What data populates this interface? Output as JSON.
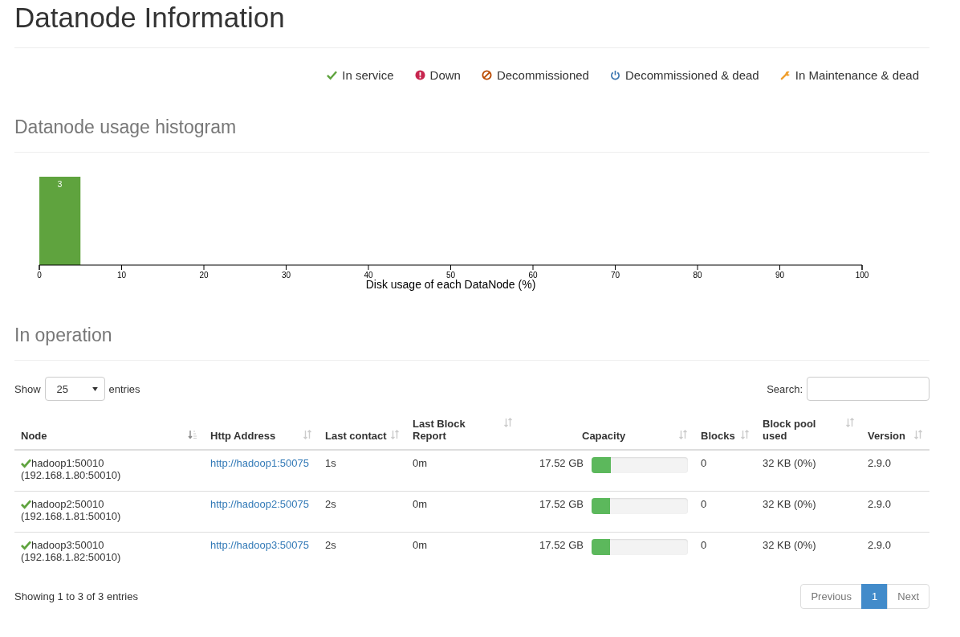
{
  "title": "Datanode Information",
  "legend": [
    {
      "kind": "in-service",
      "label": "In service"
    },
    {
      "kind": "down",
      "label": "Down"
    },
    {
      "kind": "decommissioned",
      "label": "Decommissioned"
    },
    {
      "kind": "decommissioned-dead",
      "label": "Decommissioned & dead"
    },
    {
      "kind": "maintenance-dead",
      "label": "In Maintenance & dead"
    }
  ],
  "histogram": {
    "heading": "Datanode usage histogram",
    "chart_data": {
      "type": "bar",
      "xlabel": "Disk usage of each DataNode (%)",
      "x": [
        2.5
      ],
      "values": [
        3
      ],
      "xlim": [
        0,
        100
      ],
      "xticks": [
        0,
        10,
        20,
        30,
        40,
        50,
        60,
        70,
        80,
        90,
        100
      ],
      "data_labels": true
    }
  },
  "operation": {
    "heading": "In operation",
    "show_label": "Show",
    "page_size": "25",
    "entries_label": "entries",
    "search_label": "Search:",
    "columns": [
      {
        "label": "Node",
        "sorted": true
      },
      {
        "label": "Http Address",
        "sorted": false
      },
      {
        "label": "Last contact",
        "sorted": false
      },
      {
        "label": "Last Block Report",
        "sorted": false
      },
      {
        "label": "Capacity",
        "sorted": false
      },
      {
        "label": "Blocks",
        "sorted": false
      },
      {
        "label": "Block pool used",
        "sorted": false
      },
      {
        "label": "Version",
        "sorted": false
      }
    ],
    "rows": [
      {
        "kind": "in-service",
        "node": "hadoop1:50010",
        "address": "(192.168.1.80:50010)",
        "http": "http://hadoop1:50075",
        "last_contact": "1s",
        "last_block_report": "0m",
        "capacity": "17.52 GB",
        "level": 0.2,
        "blocks": "0",
        "block_pool_used": "32 KB (0%)",
        "version": "2.9.0"
      },
      {
        "kind": "in-service",
        "node": "hadoop2:50010",
        "address": "(192.168.1.81:50010)",
        "http": "http://hadoop2:50075",
        "last_contact": "2s",
        "last_block_report": "0m",
        "capacity": "17.52 GB",
        "level": 0.19,
        "blocks": "0",
        "block_pool_used": "32 KB (0%)",
        "version": "2.9.0"
      },
      {
        "kind": "in-service",
        "node": "hadoop3:50010",
        "address": "(192.168.1.82:50010)",
        "http": "http://hadoop3:50075",
        "last_contact": "2s",
        "last_block_report": "0m",
        "capacity": "17.52 GB",
        "level": 0.19,
        "blocks": "0",
        "block_pool_used": "32 KB (0%)",
        "version": "2.9.0"
      }
    ],
    "info": "Showing 1 to 3 of 3 entries",
    "pagination": [
      {
        "label": "Previous",
        "selected": false,
        "disabled": true
      },
      {
        "label": "1",
        "selected": true,
        "disabled": false
      },
      {
        "label": "Next",
        "selected": false,
        "disabled": true
      }
    ]
  }
}
